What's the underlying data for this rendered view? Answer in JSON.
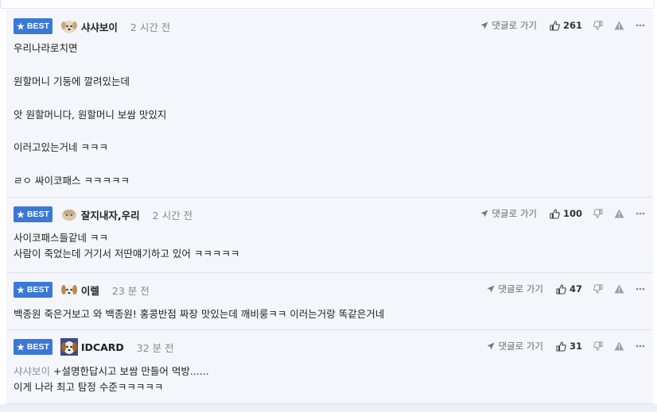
{
  "badge_label": "BEST",
  "reply_label": "댓글로 가기",
  "comments": [
    {
      "nickname": "샤샤보이",
      "time": "2 시간 전",
      "likes": "261",
      "lines": [
        "우리나라로치면",
        "",
        "원할머니 기둥에 깔려있는데",
        "",
        "앗 원할머니다, 원할머니 보쌈 맛있지",
        "",
        "이러고있는거네 ㅋㅋㅋ",
        "",
        "ㄹㅇ 싸이코패스 ㅋㅋㅋㅋㅋ"
      ]
    },
    {
      "nickname": "잘지내자,우리",
      "time": "2 시간 전",
      "likes": "100",
      "lines": [
        "사이코패스들같네 ㅋㅋ",
        "사람이 죽었는데 거기서 저딴얘기하고 있어 ㅋㅋㅋㅋㅋ"
      ]
    },
    {
      "nickname": "이렐",
      "time": "23 분 전",
      "likes": "47",
      "lines": [
        "백종원 죽은거보고 와 백종원! 홍콩반점 짜장 맛있는데 깨비룽ㅋㅋ 이러는거랑 똑같은거네"
      ]
    },
    {
      "nickname": "IDCARD",
      "time": "32 분 전",
      "likes": "31",
      "mention": "샤샤보이",
      "lines": [
        "+설명한답시고 보쌈 만들어 먹방......",
        "이게 나라 최고 탐정 수준ㅋㅋㅋㅋㅋ"
      ]
    }
  ]
}
